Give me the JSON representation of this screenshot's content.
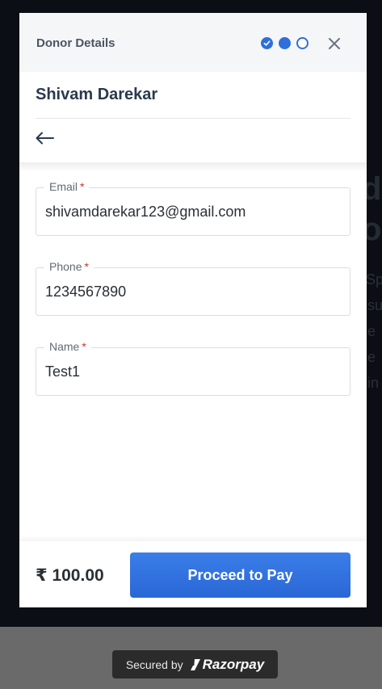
{
  "background": {
    "fragments": [
      "da",
      "o",
      "Sp",
      "su",
      "e",
      "e",
      "in"
    ]
  },
  "modal": {
    "header_title": "Donor Details",
    "steps": [
      "complete",
      "current",
      "pending"
    ],
    "donor_name": "Shivam Darekar",
    "fields": [
      {
        "label": "Email",
        "required_mark": "*",
        "value": "shivamdarekar123@gmail.com"
      },
      {
        "label": "Phone",
        "required_mark": "*",
        "value": "1234567890"
      },
      {
        "label": "Name",
        "required_mark": "*",
        "value": "Test1"
      }
    ],
    "footer": {
      "amount": "₹ 100.00",
      "pay_label": "Proceed to Pay"
    }
  },
  "secured": {
    "label": "Secured by",
    "brand": "Razorpay"
  },
  "colors": {
    "accent": "#2f6fdb",
    "required": "#d0312d"
  }
}
